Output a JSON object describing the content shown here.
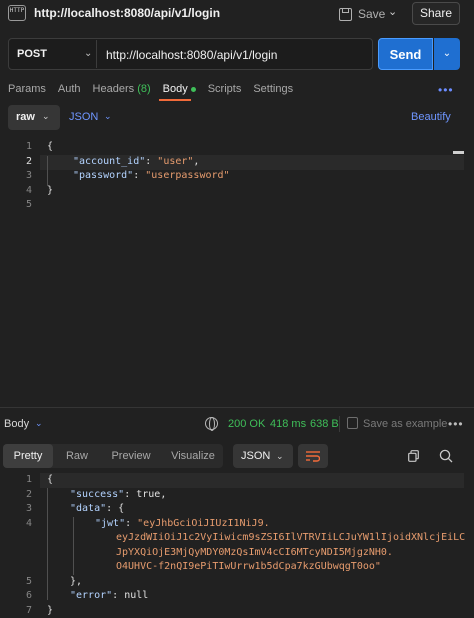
{
  "header": {
    "badge": "HTTP",
    "title": "http://localhost:8080/api/v1/login",
    "save_label": "Save",
    "share_label": "Share"
  },
  "request": {
    "method": "POST",
    "url": "http://localhost:8080/api/v1/login",
    "send_label": "Send"
  },
  "tabs": {
    "params": "Params",
    "auth": "Auth",
    "headers": "Headers",
    "headers_count": "(8)",
    "body": "Body",
    "scripts": "Scripts",
    "settings": "Settings",
    "more": "•••"
  },
  "body_toolbar": {
    "mode": "raw",
    "language": "JSON",
    "beautify": "Beautify"
  },
  "request_body": {
    "line_numbers": [
      "1",
      "2",
      "3",
      "4",
      "5"
    ],
    "account_key": "\"account_id\"",
    "account_value": "\"user\"",
    "password_key": "\"password\"",
    "password_value": "\"userpassword\""
  },
  "response": {
    "label": "Body",
    "status": "200 OK",
    "time": "418 ms",
    "size": "638 B",
    "save_example": "Save as example",
    "more": "•••",
    "tabs": [
      "Pretty",
      "Raw",
      "Preview",
      "Visualize"
    ],
    "format": "JSON",
    "line_numbers": [
      "1",
      "2",
      "3",
      "4",
      "",
      "",
      "",
      "5",
      "6",
      "7"
    ],
    "success_key": "\"success\"",
    "success_value": "true",
    "data_key": "\"data\"",
    "jwt_key": "\"jwt\"",
    "jwt_line1": "\"eyJhbGciOiJIUzI1NiJ9.",
    "jwt_line2": "eyJzdWIiOiJ1c2VyIiwicm9sZSI6IlVTRVIiLCJuYW1lIjoidXNlcjEiLC",
    "jwt_line3": "JpYXQiOjE3MjQyMDY0MzQsImV4cCI6MTcyNDI5MjgzNH0.",
    "jwt_line4": "O4UHVC-f2nQI9ePiTIwUrrw1b5dCpa7kzGUbwqgT0oo\"",
    "error_key": "\"error\"",
    "error_value": "null"
  },
  "colors": {
    "accent_blue": "#1f6fd1",
    "status_green": "#3fbf59",
    "active_tab_orange": "#f26b3a",
    "json_key": "#b3d3ff",
    "json_string": "#e79c6e"
  }
}
